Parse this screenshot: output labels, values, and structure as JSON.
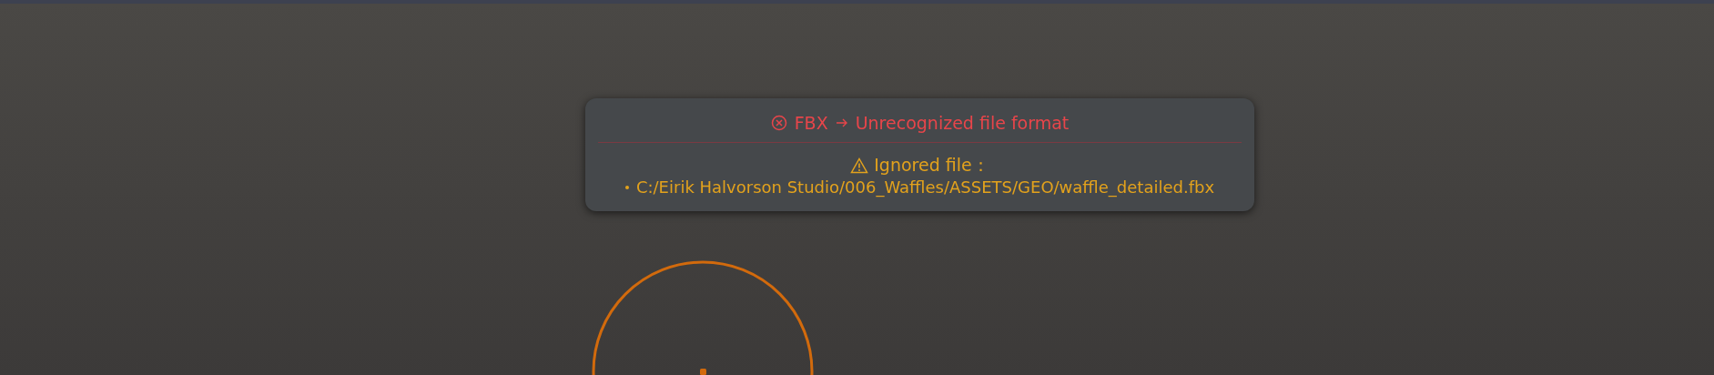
{
  "notification": {
    "error": {
      "format": "FBX",
      "message": "Unrecognized file format"
    },
    "warning": {
      "label": "Ignored file：",
      "files": [
        "C:/Eirik Halvorson Studio/006_Waffles/ASSETS/GEO/waffle_detailed.fbx"
      ]
    }
  }
}
